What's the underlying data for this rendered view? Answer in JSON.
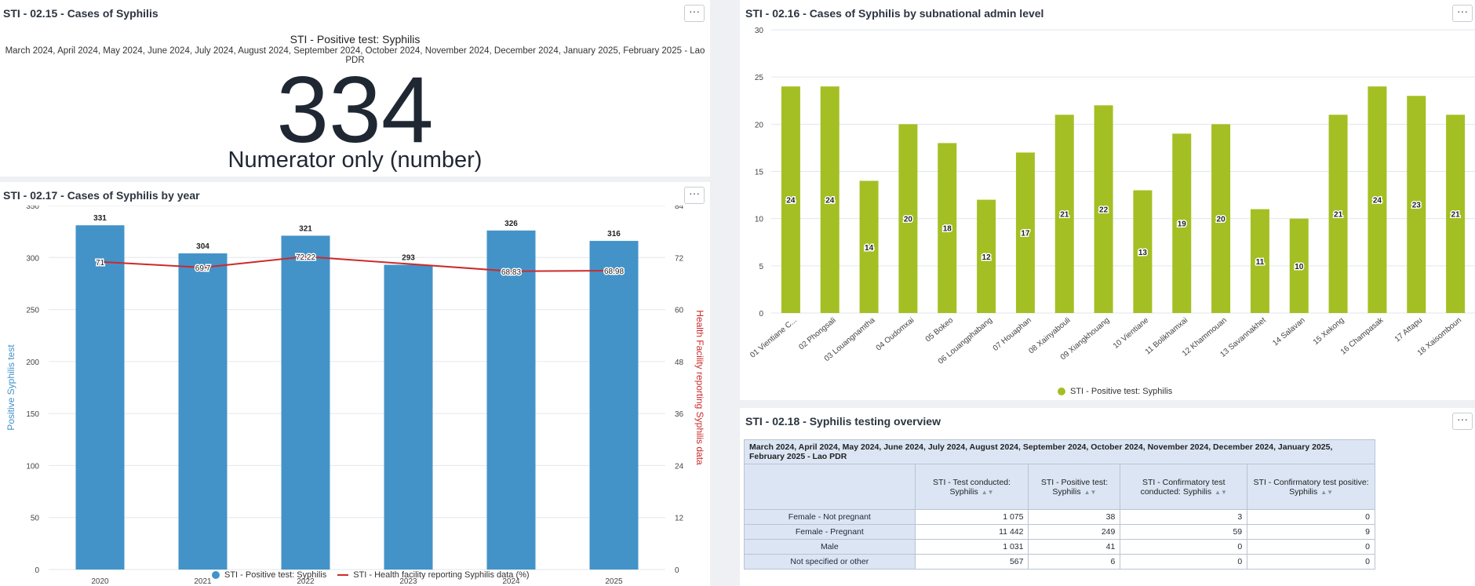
{
  "panel_single": {
    "title": "STI - 02.15 - Cases of Syphilis",
    "heading": "STI - Positive test: Syphilis",
    "periods": "March 2024, April 2024, May 2024, June 2024, July 2024, August 2024, September 2024, October 2024, November 2024, December 2024, January 2025, February 2025 - Lao PDR",
    "value": "334",
    "value_label": "Numerator only (number)",
    "menu": "···"
  },
  "panel_year": {
    "title": "STI - 02.17 - Cases of Syphilis by year",
    "menu": "···",
    "legend": [
      "STI - Positive test: Syphilis",
      "STI - Health facility reporting Syphilis data (%)"
    ],
    "colors": {
      "bar": "#4393c9",
      "line": "#cd2a2a"
    }
  },
  "panel_admin": {
    "title": "STI - 02.16 - Cases of Syphilis by subnational admin level",
    "menu": "···",
    "legend": "STI - Positive test: Syphilis",
    "colors": {
      "bar": "#a4bf23"
    }
  },
  "panel_table": {
    "title": "STI - 02.18 - Syphilis testing overview",
    "menu": "···",
    "header": "March 2024, April 2024, May 2024, June 2024, July 2024, August 2024, September 2024, October 2024, November 2024, December 2024, January 2025, February 2025 - Lao PDR",
    "columns": [
      "STI - Test conducted: Syphilis",
      "STI - Positive test: Syphilis",
      "STI - Confirmatory test conducted: Syphilis",
      "STI - Confirmatory test positive: Syphilis"
    ],
    "rows": [
      {
        "label": "Female - Not pregnant",
        "values": [
          "1 075",
          "38",
          "3",
          "0"
        ]
      },
      {
        "label": "Female - Pregnant",
        "values": [
          "11 442",
          "249",
          "59",
          "9"
        ]
      },
      {
        "label": "Male",
        "values": [
          "1 031",
          "41",
          "0",
          "0"
        ]
      },
      {
        "label": "Not specified or other",
        "values": [
          "567",
          "6",
          "0",
          "0"
        ]
      }
    ]
  },
  "chart_data": [
    {
      "type": "bar",
      "categories": [
        "2020",
        "2021",
        "2022",
        "2023",
        "2024",
        "2025"
      ],
      "series": [
        {
          "name": "STI - Positive test: Syphilis",
          "values": [
            331,
            304,
            321,
            293,
            326,
            316
          ],
          "axis": "left"
        },
        {
          "name": "STI - Health facility reporting Syphilis data (%)",
          "type": "line",
          "values": [
            71,
            69.7,
            72.22,
            null,
            68.83,
            68.98
          ],
          "axis": "right"
        }
      ],
      "ylabel": "Positive Syphilis test",
      "y2label": "Health Facility reporting Syphilis data",
      "ylim": [
        0,
        350
      ],
      "y2lim": [
        0,
        84
      ],
      "yticks": [
        0,
        50,
        100,
        150,
        200,
        250,
        300,
        350
      ],
      "y2ticks": [
        0,
        12,
        24,
        36,
        48,
        60,
        72,
        84
      ],
      "legend": "bottom"
    },
    {
      "type": "bar",
      "categories": [
        "01 Vientiane C...",
        "02 Phongsali",
        "03 Louangnamtha",
        "04 Oudomxai",
        "05 Bokeo",
        "06 Louangphabang",
        "07 Houaphan",
        "08 Xainyabouli",
        "09 Xiangkhouang",
        "10 Vientiane",
        "11 Bolikhamxai",
        "12 Khammouan",
        "13 Savannakhet",
        "14 Salavan",
        "15 Xekong",
        "16 Champasak",
        "17 Attapu",
        "18 Xaisomboun"
      ],
      "series": [
        {
          "name": "STI - Positive test: Syphilis",
          "values": [
            24,
            24,
            14,
            20,
            18,
            12,
            17,
            21,
            22,
            13,
            19,
            20,
            11,
            10,
            21,
            24,
            23,
            21
          ]
        }
      ],
      "ylim": [
        0,
        30
      ],
      "yticks": [
        0,
        5,
        10,
        15,
        20,
        25,
        30
      ],
      "legend": "bottom"
    }
  ]
}
